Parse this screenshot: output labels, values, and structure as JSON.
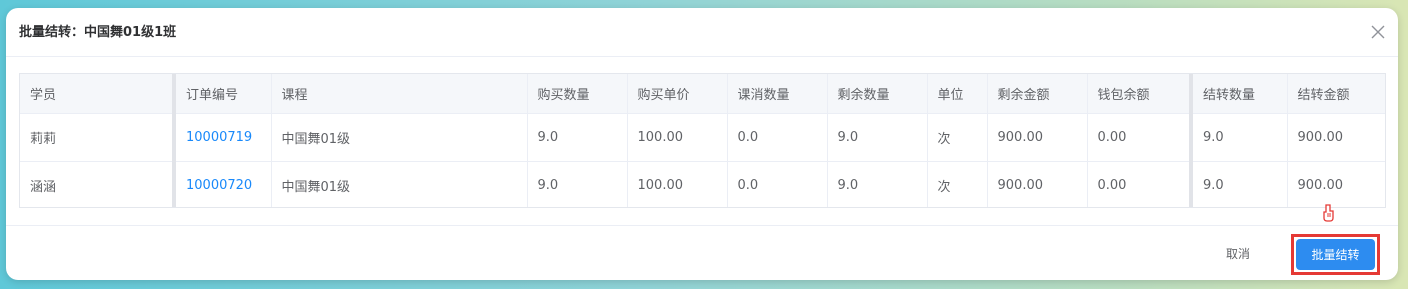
{
  "dialog": {
    "title": "批量结转：中国舞01级1班",
    "close_icon": "close-icon"
  },
  "table": {
    "columns": [
      "学员",
      "订单编号",
      "课程",
      "购买数量",
      "购买单价",
      "课消数量",
      "剩余数量",
      "单位",
      "剩余金额",
      "钱包余额",
      "结转数量",
      "结转金额"
    ],
    "rows": [
      {
        "student": "莉莉",
        "order_no": "10000719",
        "course": "中国舞01级",
        "buy_qty": "9.0",
        "unit_price": "100.00",
        "consumed_qty": "0.0",
        "remain_qty": "9.0",
        "unit": "次",
        "remain_amount": "900.00",
        "wallet_balance": "0.00",
        "transfer_qty": "9.0",
        "transfer_amount": "900.00"
      },
      {
        "student": "涵涵",
        "order_no": "10000720",
        "course": "中国舞01级",
        "buy_qty": "9.0",
        "unit_price": "100.00",
        "consumed_qty": "0.0",
        "remain_qty": "9.0",
        "unit": "次",
        "remain_amount": "900.00",
        "wallet_balance": "0.00",
        "transfer_qty": "9.0",
        "transfer_amount": "900.00"
      }
    ]
  },
  "footer": {
    "cancel_label": "取消",
    "confirm_label": "批量结转"
  },
  "colors": {
    "primary": "#2d8cf0",
    "link": "#1989fa",
    "highlight": "#e53935"
  }
}
